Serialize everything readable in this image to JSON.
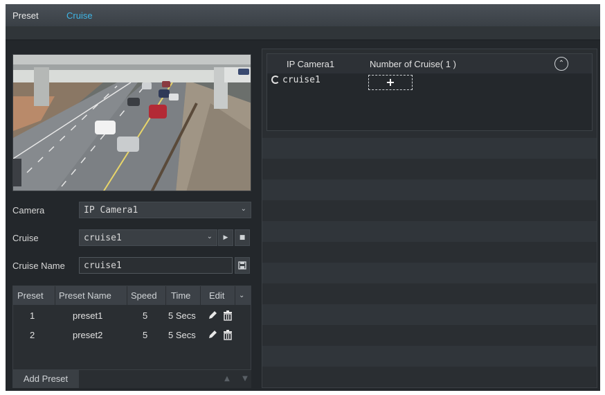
{
  "tabs": [
    {
      "label": "Preset",
      "active": false
    },
    {
      "label": "Cruise",
      "active": true
    }
  ],
  "form": {
    "camera_label": "Camera",
    "camera_value": "IP Camera1",
    "cruise_label": "Cruise",
    "cruise_value": "cruise1",
    "cruise_name_label": "Cruise Name",
    "cruise_name_value": "cruise1"
  },
  "preset_table": {
    "columns": [
      "Preset",
      "Preset Name",
      "Speed",
      "Time",
      "Edit"
    ],
    "rows": [
      {
        "preset": "1",
        "name": "preset1",
        "speed": "5",
        "time": "5 Secs"
      },
      {
        "preset": "2",
        "name": "preset2",
        "speed": "5",
        "time": "5 Secs"
      }
    ]
  },
  "add_preset_label": "Add Preset",
  "cruise_table": {
    "camera_header": "IP Camera1",
    "count_header": "Number of Cruise( 1 )",
    "items": [
      "cruise1"
    ],
    "add_symbol": "+"
  },
  "icons": {
    "play": "play-icon",
    "stop": "stop-icon",
    "save": "save-icon",
    "edit": "pencil-icon",
    "delete": "trash-icon",
    "collapse": "chevron-up-icon",
    "dropdown": "chevron-down-icon"
  },
  "colors": {
    "accent": "#3fb6e6",
    "panel": "#23272b"
  }
}
